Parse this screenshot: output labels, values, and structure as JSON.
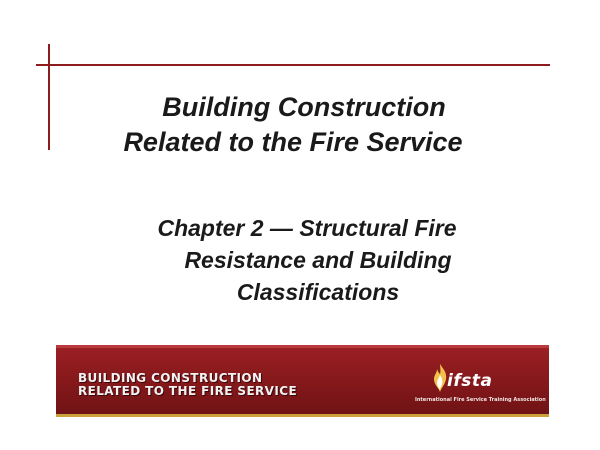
{
  "slide": {
    "title_lines": [
      "Building Construction",
      "Related to the Fire Service"
    ],
    "subtitle_lines": [
      "Chapter 2 — Structural Fire",
      "Resistance and Building",
      "Classifications"
    ]
  },
  "banner": {
    "text_lines": [
      "BUILDING CONSTRUCTION",
      "RELATED TO THE FIRE SERVICE"
    ],
    "logo_text": "ifsta",
    "logo_caption": "International Fire Service Training Association",
    "logo_icon": "flame-icon"
  },
  "colors": {
    "accent": "#8e1b1e",
    "banner_bg": "#8a1a1d",
    "banner_stripe": "#c9a23a",
    "text": "#1a1a1a"
  }
}
